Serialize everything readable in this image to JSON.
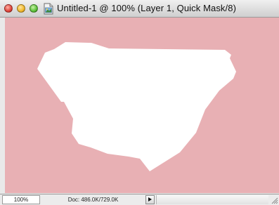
{
  "window": {
    "title": "Untitled-1 @ 100% (Layer 1, Quick Mask/8)"
  },
  "titlebar": {
    "buttons": [
      "close",
      "minimize",
      "zoom"
    ],
    "document_icon": "photoshop-document-icon"
  },
  "canvas": {
    "mask_color": "#e8b0b4",
    "selection_color": "#ffffff"
  },
  "statusbar": {
    "zoom": "100%",
    "doc_info": "Doc: 486.0K/729.0K"
  }
}
